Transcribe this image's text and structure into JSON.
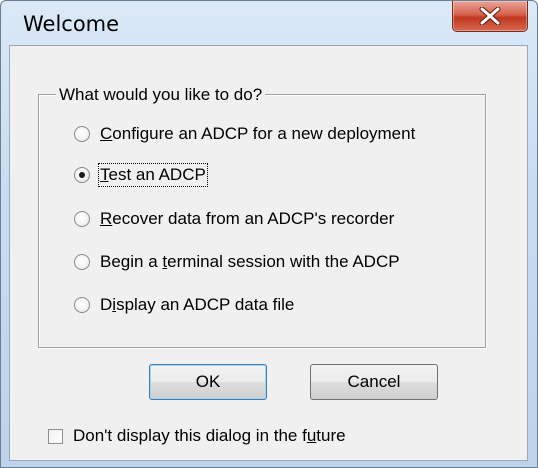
{
  "window": {
    "title": "Welcome",
    "close_icon": "close-icon"
  },
  "group": {
    "label": "What would you like to do?",
    "options": [
      {
        "pre": "",
        "accel": "C",
        "post": "onfigure an ADCP for a new deployment",
        "checked": false
      },
      {
        "pre": "",
        "accel": "T",
        "post": "est an ADCP",
        "checked": true
      },
      {
        "pre": "",
        "accel": "R",
        "post": "ecover data from an ADCP's recorder",
        "checked": false
      },
      {
        "pre": "Begin a ",
        "accel": "t",
        "post": "erminal session with the ADCP",
        "checked": false
      },
      {
        "pre": "D",
        "accel": "i",
        "post": "splay an ADCP data file",
        "checked": false
      }
    ]
  },
  "buttons": {
    "ok": "OK",
    "cancel": "Cancel"
  },
  "checkbox": {
    "pre": "Don't display this dialog in the f",
    "accel": "u",
    "post": "ture",
    "checked": false
  }
}
